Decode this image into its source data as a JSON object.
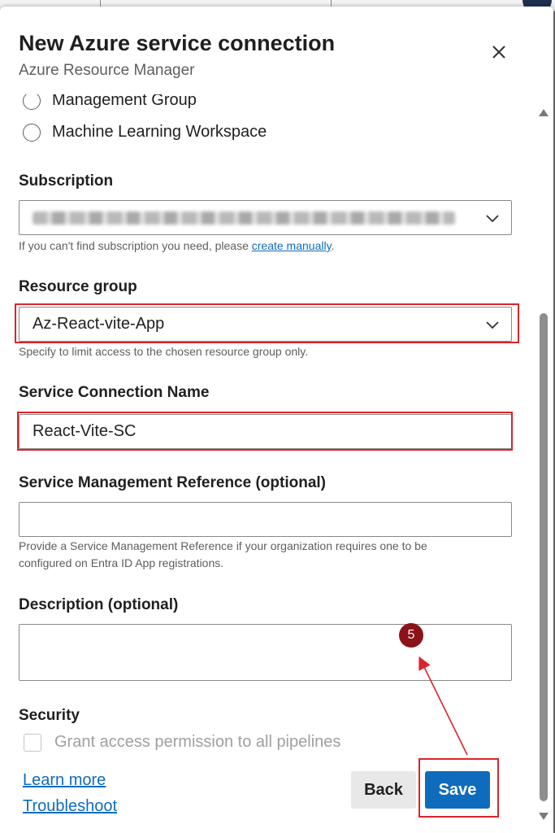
{
  "dialog": {
    "title": "New Azure service connection",
    "subtitle": "Azure Resource Manager"
  },
  "scope_options": [
    {
      "label": "Management Group",
      "selected": false
    },
    {
      "label": "Machine Learning Workspace",
      "selected": false
    }
  ],
  "subscription": {
    "label": "Subscription",
    "helper_prefix": "If you can't find subscription you need, please ",
    "helper_link": "create manually",
    "helper_suffix": "."
  },
  "resource_group": {
    "label": "Resource group",
    "value": "Az-React-vite-App",
    "helper": "Specify to limit access to the chosen resource group only."
  },
  "service_connection_name": {
    "label": "Service Connection Name",
    "value": "React-Vite-SC"
  },
  "service_management_reference": {
    "label": "Service Management Reference (optional)",
    "value": "",
    "helper_line1": "Provide a Service Management Reference if your organization requires one to be",
    "helper_line2": "configured on Entra ID App registrations."
  },
  "description": {
    "label": "Description (optional)",
    "value": ""
  },
  "annotation": {
    "step_number": "5",
    "highlight_color": "#d9252b",
    "badge_color": "#8b1218"
  },
  "security": {
    "label": "Security",
    "checkbox_label": "Grant access permission to all pipelines",
    "checked": false
  },
  "footer": {
    "learn_more": "Learn more",
    "troubleshoot": "Troubleshoot",
    "back_label": "Back",
    "save_label": "Save"
  },
  "colors": {
    "primary": "#0f6cbd",
    "text": "#201f1e",
    "muted": "#605e5c"
  }
}
